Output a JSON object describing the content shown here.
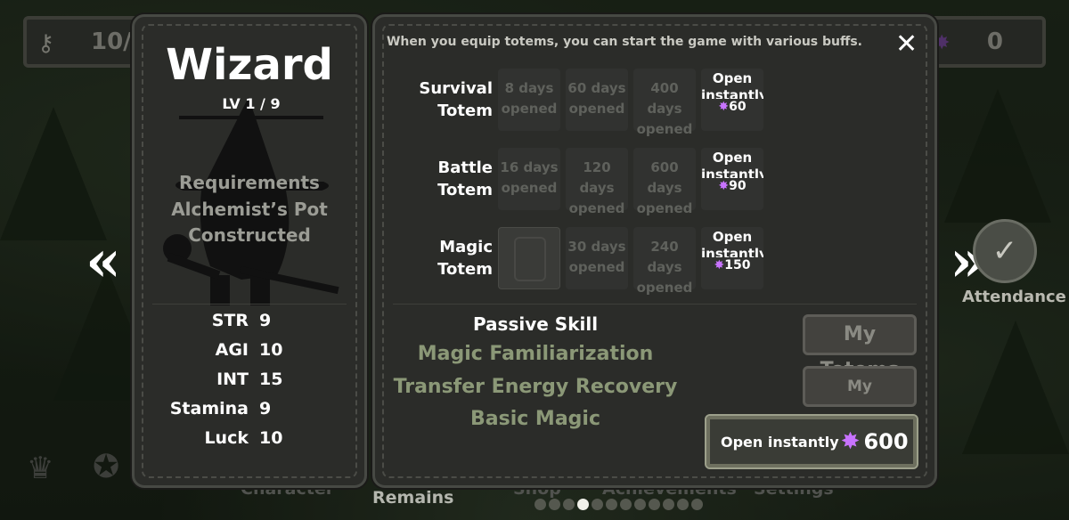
{
  "hud": {
    "keys_value": "10/",
    "gems_value": "0"
  },
  "character": {
    "name": "Wizard",
    "level": "LV 1 / 9",
    "requirement_title": "Requirements",
    "requirement_line1": "Alchemist’s Pot",
    "requirement_line2": "Constructed",
    "stats": [
      {
        "name": "STR",
        "value": "9"
      },
      {
        "name": "AGI",
        "value": "10"
      },
      {
        "name": "INT",
        "value": "15"
      },
      {
        "name": "Stamina",
        "value": "9"
      },
      {
        "name": "Luck",
        "value": "10"
      }
    ]
  },
  "totems": {
    "info": "When you equip totems, you can start the game with various buffs.",
    "rows": [
      {
        "label_line1": "Survival",
        "label_line2": "Totem",
        "slots": [
          {
            "line1": "8 days",
            "line2": "opened"
          },
          {
            "line1": "60 days",
            "line2": "opened"
          },
          {
            "line1": "400 days",
            "line2": "opened"
          }
        ],
        "open_line1": "Open",
        "open_line2": "instantly",
        "open_price": "60"
      },
      {
        "label_line1": "Battle",
        "label_line2": "Totem",
        "slots": [
          {
            "line1": "16 days",
            "line2": "opened"
          },
          {
            "line1": "120 days",
            "line2": "opened"
          },
          {
            "line1": "600 days",
            "line2": "opened"
          }
        ],
        "open_line1": "Open",
        "open_line2": "instantly",
        "open_price": "90"
      },
      {
        "label_line1": "Magic",
        "label_line2": "Totem",
        "slots": [
          {
            "line1": "",
            "line2": ""
          },
          {
            "line1": "30 days",
            "line2": "opened"
          },
          {
            "line1": "240 days",
            "line2": "opened"
          }
        ],
        "open_line1": "Open",
        "open_line2": "instantly",
        "open_price": "150"
      }
    ]
  },
  "passive": {
    "title": "Passive Skill",
    "skills": [
      "Magic Familiarization",
      "Transfer Energy Recovery",
      "Basic Magic"
    ]
  },
  "buttons": {
    "my_totems": "My Totems",
    "my_blueprints": "My Blueprints",
    "open_instantly": "Open instantly",
    "open_instantly_price": "600"
  },
  "side": {
    "attendance": "Attendance"
  },
  "bottom_tabs": {
    "character": "Character",
    "remains": "Remains",
    "shop": "Shop",
    "achievements": "Achievements",
    "settings": "Settings"
  },
  "pager": {
    "total": 12,
    "active_index": 3
  },
  "colors": {
    "gem": "#c873ff",
    "skill_text": "#8b9877",
    "panel_bg": "#2b2c29"
  }
}
